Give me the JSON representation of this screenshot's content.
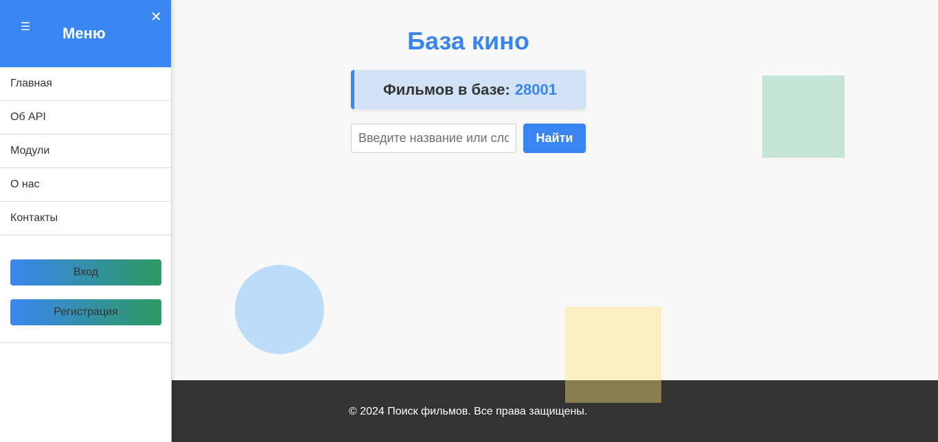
{
  "sidebar": {
    "menu_toggle_glyph": "☰",
    "title": "Меню",
    "close_glyph": "✕",
    "items": [
      {
        "label": "Главная"
      },
      {
        "label": "Об API"
      },
      {
        "label": "Модули"
      },
      {
        "label": "О нас"
      },
      {
        "label": "Контакты"
      }
    ],
    "login_label": "Вход",
    "register_label": "Регистрация"
  },
  "main": {
    "title": "База кино",
    "stats_label": "Фильмов в базе:",
    "stats_count": "28001",
    "search": {
      "placeholder": "Введите название или слово",
      "button_label": "Найти"
    }
  },
  "footer": {
    "text": "© 2024 Поиск фильмов. Все права защищены."
  },
  "colors": {
    "accent": "#3a86f0",
    "accent_green": "#2e9960",
    "footer_bg": "#333333",
    "page_bg": "#f8f8f8"
  }
}
